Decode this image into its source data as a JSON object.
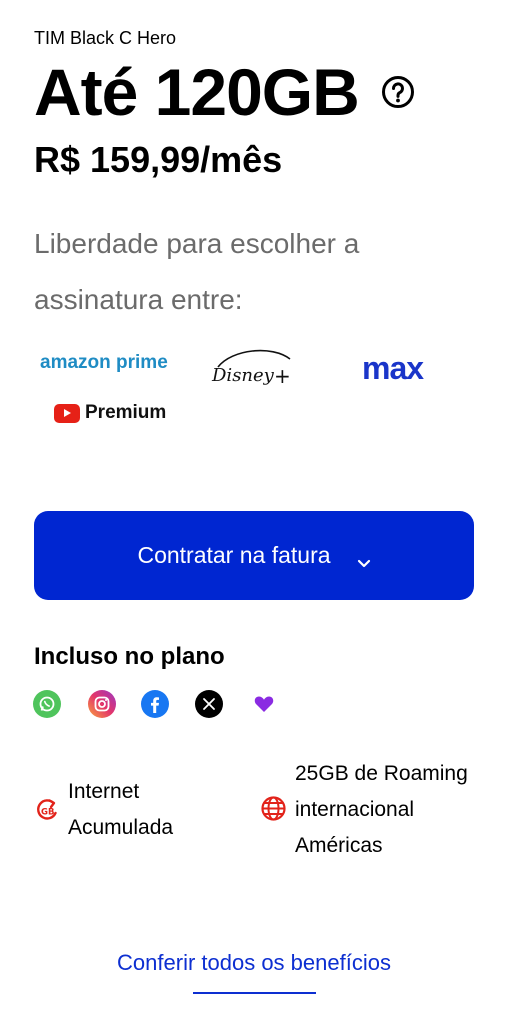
{
  "plan": {
    "name": "TIM Black C Hero",
    "headline": "Até 120GB",
    "price": "R$ 159,99/mês",
    "description": "Liberdade para escolher a assinatura entre:"
  },
  "streaming_logos": {
    "amazon": "amazon prime",
    "disney": "Disney+",
    "max": "max",
    "youtube": "Premium"
  },
  "cta": {
    "label": "Contratar na fatura"
  },
  "included": {
    "title": "Incluso no plano",
    "apps": [
      "whatsapp-icon",
      "instagram-icon",
      "facebook-icon",
      "x-icon",
      "tim-heart-icon"
    ],
    "features": [
      {
        "icon": "internet-accumulated-icon",
        "line1": "Internet",
        "line2": "Acumulada"
      },
      {
        "icon": "globe-icon",
        "line1": "25GB de Roaming",
        "line2": "internacional",
        "line3": "Américas"
      }
    ]
  },
  "footer": {
    "link": "Conferir todos os benefícios"
  },
  "colors": {
    "primary": "#0026d1",
    "link": "#0d2fd1",
    "accent_red": "#e2231a"
  }
}
